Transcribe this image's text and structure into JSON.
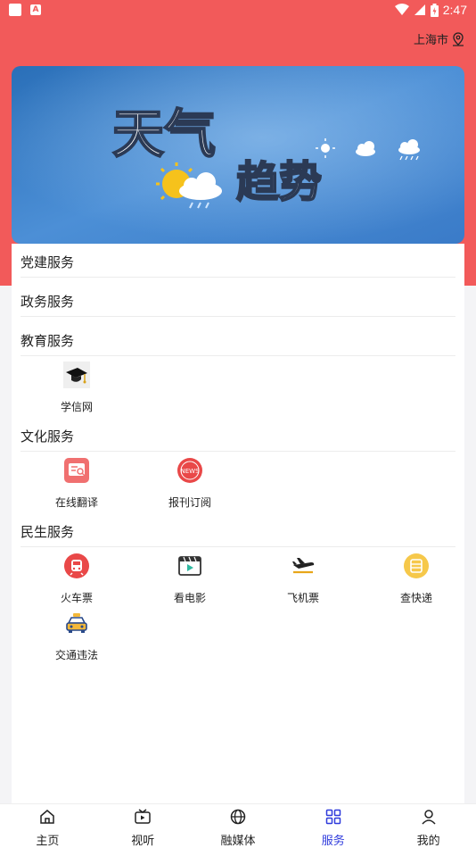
{
  "status": {
    "time": "2:47"
  },
  "header": {
    "city": "上海市"
  },
  "banner": {
    "line1": "天气",
    "line2": "趋势"
  },
  "sections": [
    {
      "title": "党建服务"
    },
    {
      "title": "政务服务"
    },
    {
      "title": "教育服务",
      "items": [
        "学信网"
      ]
    },
    {
      "title": "文化服务",
      "items": [
        "在线翻译",
        "报刊订阅"
      ]
    },
    {
      "title": "民生服务",
      "items": [
        "火车票",
        "看电影",
        "飞机票",
        "查快递",
        "交通违法"
      ]
    }
  ],
  "tabs": [
    "主页",
    "视听",
    "融媒体",
    "服务",
    "我的"
  ],
  "active_tab": "服务",
  "colors": {
    "header": "#f25a5a",
    "accent": "#2f3bdc"
  },
  "icons": {
    "education": "graduation-cap-icon",
    "translate": "translate-icon",
    "newspaper": "news-icon",
    "train": "train-icon",
    "movie": "movie-icon",
    "plane": "plane-icon",
    "express": "express-icon",
    "traffic": "taxi-icon"
  }
}
